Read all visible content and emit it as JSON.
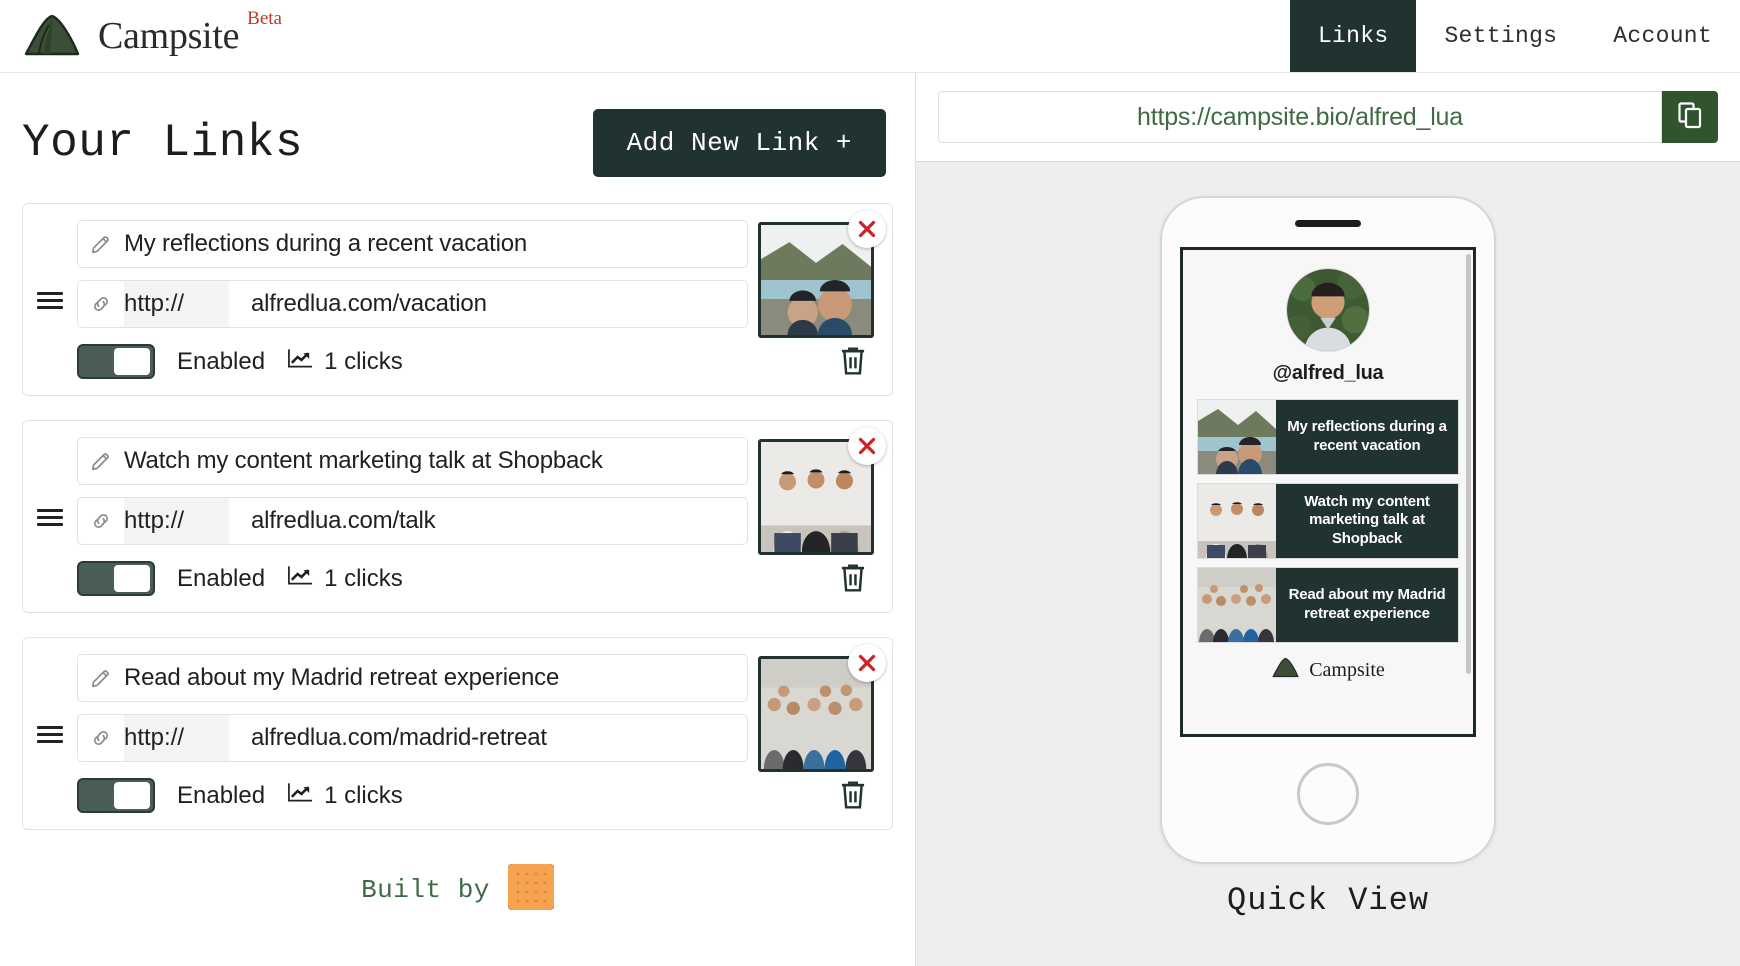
{
  "header": {
    "brand_name": "Campsite",
    "beta_label": "Beta",
    "logo_icon": "tent-icon",
    "nav": [
      {
        "label": "Links",
        "active": true
      },
      {
        "label": "Settings",
        "active": false
      },
      {
        "label": "Account",
        "active": false
      }
    ]
  },
  "main": {
    "page_title": "Your Links",
    "add_button_label": "Add New Link +",
    "links": [
      {
        "title": "My reflections during a recent vacation",
        "protocol": "http://",
        "url": "alfredlua.com/vacation",
        "toggle_label": "Enabled",
        "enabled": true,
        "clicks_label": "1 clicks",
        "thumb_icon": "couple-lake-photo"
      },
      {
        "title": "Watch my content marketing talk at Shopback",
        "protocol": "http://",
        "url": "alfredlua.com/talk",
        "toggle_label": "Enabled",
        "enabled": true,
        "clicks_label": "1 clicks",
        "thumb_icon": "three-men-photo"
      },
      {
        "title": "Read about my Madrid retreat experience",
        "protocol": "http://",
        "url": "alfredlua.com/madrid-retreat",
        "toggle_label": "Enabled",
        "enabled": true,
        "clicks_label": "1 clicks",
        "thumb_icon": "group-crowd-photo"
      }
    ],
    "footer": {
      "built_by_label": "Built by",
      "built_by_logo": "cracker-logo"
    }
  },
  "preview": {
    "public_url": "https://campsite.bio/alfred_lua",
    "copy_icon": "copy-icon",
    "quick_view_label": "Quick View",
    "profile": {
      "handle": "@alfred_lua",
      "avatar_icon": "user-avatar-photo"
    },
    "link_cards": [
      {
        "title": "My reflections during a recent vacation",
        "thumb_icon": "couple-lake-photo"
      },
      {
        "title": "Watch my content marketing talk at Shopback",
        "thumb_icon": "three-men-photo"
      },
      {
        "title": "Read about my Madrid retreat experience",
        "thumb_icon": "group-crowd-photo"
      }
    ],
    "footer_brand": "Campsite"
  },
  "colors": {
    "dark_green": "#213331",
    "accent_green": "#3f6b44",
    "copy_green": "#31542f",
    "red": "#c0392b",
    "orange": "#f5a council"
  }
}
